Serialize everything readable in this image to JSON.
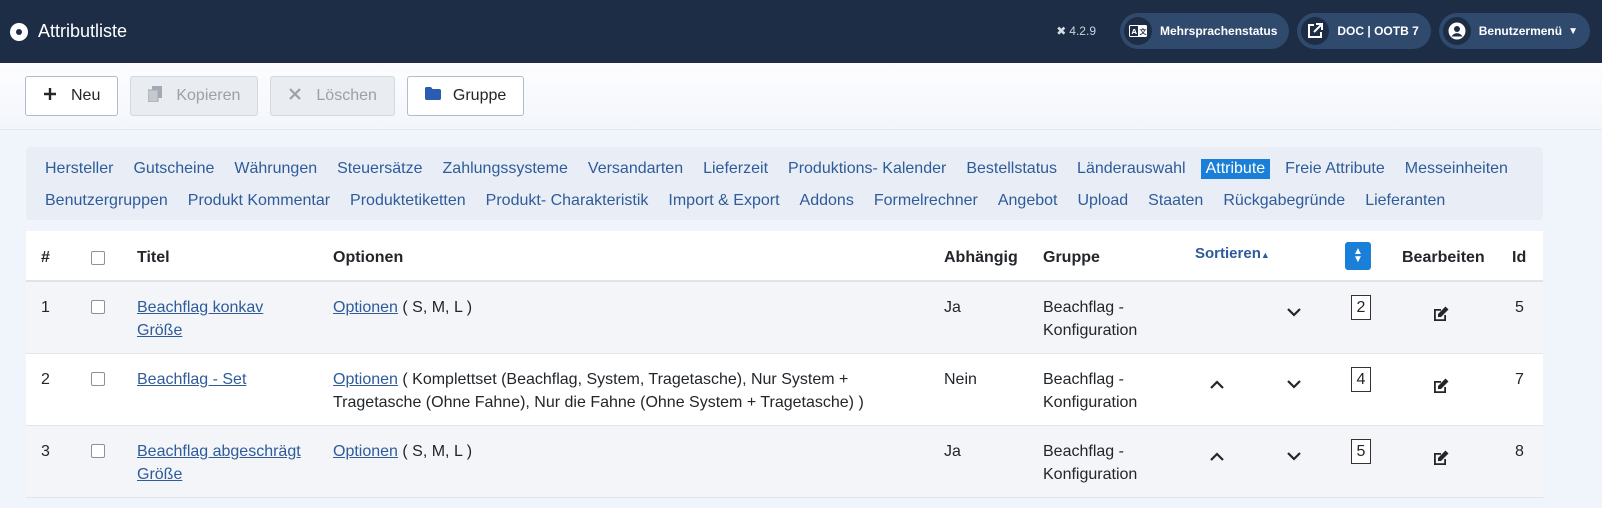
{
  "header": {
    "title": "Attributliste",
    "version": "4.2.9",
    "pills": [
      {
        "label": "Mehrsprachenstatus",
        "icon": "language-icon"
      },
      {
        "label": "DOC | OOTB 7",
        "icon": "external-link-icon"
      },
      {
        "label": "Benutzermenü",
        "icon": "user-icon"
      }
    ]
  },
  "toolbar": {
    "new_label": "Neu",
    "copy_label": "Kopieren",
    "delete_label": "Löschen",
    "group_label": "Gruppe"
  },
  "submenu": {
    "row1": [
      "Hersteller",
      "Gutscheine",
      "Währungen",
      "Steuersätze",
      "Zahlungssysteme",
      "Versandarten",
      "Lieferzeit",
      "Produktions- Kalender",
      "Bestellstatus",
      "Länderauswahl",
      "Attribute",
      "Freie Attribute",
      "Messeinheiten"
    ],
    "row2": [
      "Benutzergruppen",
      "Produkt Kommentar",
      "Produktetiketten",
      "Produkt- Charakteristik",
      "Import & Export",
      "Addons",
      "Formelrechner",
      "Angebot",
      "Upload",
      "Staaten",
      "Rückgabegründe",
      "Lieferanten"
    ],
    "active": "Attribute"
  },
  "table": {
    "headers": {
      "num": "#",
      "title": "Titel",
      "options": "Optionen",
      "dependent": "Abhängig",
      "group": "Gruppe",
      "sort": "Sortieren",
      "edit": "Bearbeiten",
      "id": "Id"
    },
    "rows": [
      {
        "num": "1",
        "title_line1": "Beachflag konkav",
        "title_line2": "Größe",
        "options_link": "Optionen",
        "options_text": " ( S, M, L )",
        "options_text2": "",
        "dependent": "Ja",
        "group_line1": "Beachflag -",
        "group_line2": "Konfiguration",
        "order": "2",
        "id": "5",
        "has_up": false
      },
      {
        "num": "2",
        "title_line1": "Beachflag - Set",
        "title_line2": "",
        "options_link": "Optionen",
        "options_text": " ( Komplettset (Beachflag, System, Tragetasche), Nur System +",
        "options_text2": "Tragetasche (Ohne Fahne), Nur die Fahne (Ohne System + Tragetasche) )",
        "dependent": "Nein",
        "group_line1": "Beachflag -",
        "group_line2": "Konfiguration",
        "order": "4",
        "id": "7",
        "has_up": true
      },
      {
        "num": "3",
        "title_line1": "Beachflag abgeschrägt",
        "title_line2": "Größe",
        "options_link": "Optionen",
        "options_text": " ( S, M, L )",
        "options_text2": "",
        "dependent": "Ja",
        "group_line1": "Beachflag -",
        "group_line2": "Konfiguration",
        "order": "5",
        "id": "8",
        "has_up": true
      }
    ]
  }
}
